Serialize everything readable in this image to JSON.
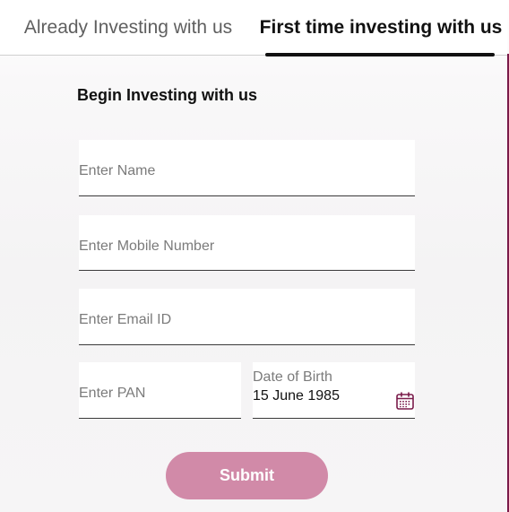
{
  "tabs": {
    "existing_label": "Already Investing with us",
    "new_label": "First time investing with us"
  },
  "form": {
    "title": "Begin Investing with us",
    "name_placeholder": "Enter Name",
    "mobile_placeholder": "Enter Mobile Number",
    "email_placeholder": "Enter Email ID",
    "pan_placeholder": "Enter PAN",
    "dob_label": "Date of Birth",
    "dob_value": "15 June 1985",
    "submit_label": "Submit"
  },
  "icons": {
    "calendar": "calendar-icon"
  },
  "colors": {
    "accent": "#7a1b4a",
    "submit_bg": "#d18aa8",
    "active_tab": "#111111",
    "inactive_tab": "#5f5f5f"
  }
}
